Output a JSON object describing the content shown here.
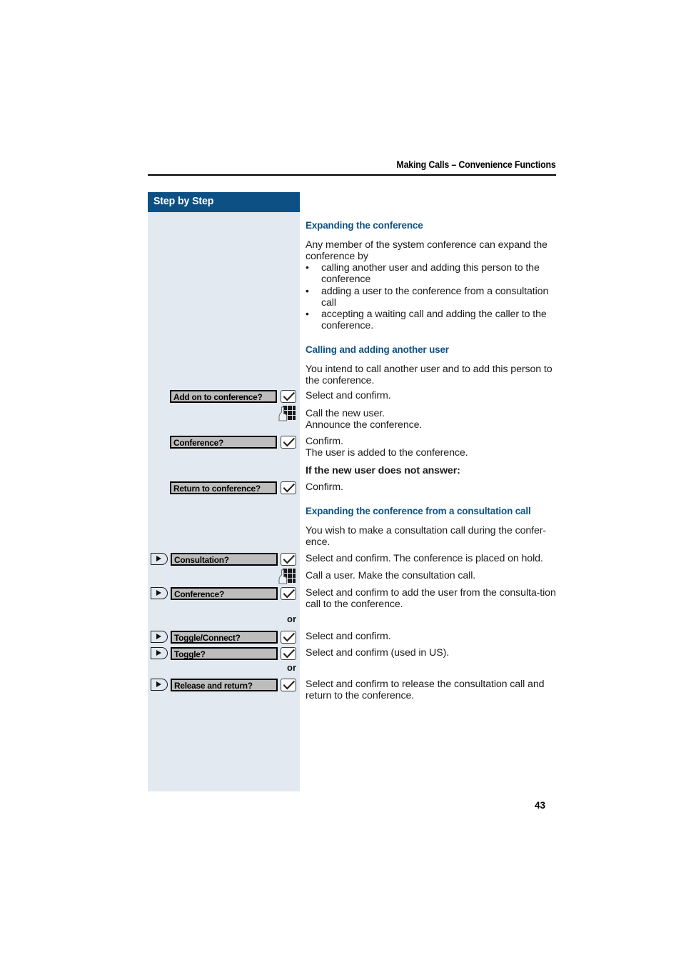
{
  "page": {
    "header_title": "Making Calls – Convenience Functions",
    "number": "43"
  },
  "sidebar": {
    "title": "Step by Step",
    "bar_color": "#0d5184",
    "background_color": "#e2e9f1",
    "or_labels": [
      "or",
      "or"
    ],
    "rows": [
      {
        "icon": "none",
        "field": "Add on to conference?",
        "button": "ok-check-button"
      },
      {
        "icon": "keypad-hand-icon",
        "field": null,
        "button": null
      },
      {
        "icon": "none",
        "field": "Conference?",
        "button": "ok-check-button"
      },
      {
        "icon": "none",
        "field": "Return to conference?",
        "button": "ok-check-button"
      },
      {
        "icon": "scroll-arrow-icon",
        "field": "Consultation?",
        "button": "ok-check-button"
      },
      {
        "icon": "keypad-hand-icon",
        "field": null,
        "button": null
      },
      {
        "icon": "scroll-arrow-icon",
        "field": "Conference?",
        "button": "ok-check-button"
      },
      {
        "icon": "scroll-arrow-icon",
        "field": "Toggle/Connect?",
        "button": "ok-check-button"
      },
      {
        "icon": "scroll-arrow-icon",
        "field": "Toggle?",
        "button": "ok-check-button"
      },
      {
        "icon": "scroll-arrow-icon",
        "field": "Release and return?",
        "button": "ok-check-button"
      }
    ]
  },
  "main": {
    "heading_color": "#0d5184",
    "section1": {
      "heading": "Expanding the conference",
      "intro": "Any member of the system conference can expand the conference by",
      "bullets": [
        "calling another user and adding this person to the conference",
        "adding a user to the conference from a consultation call",
        "accepting a waiting call and adding the caller to the conference."
      ]
    },
    "section2": {
      "heading": "Calling and adding another user",
      "intro": "You intend to call another user and to add this person to the conference.",
      "step1": "Select and confirm.",
      "step2_line1": "Call the new user.",
      "step2_line2": "Announce the conference.",
      "step3_line1": "Confirm.",
      "step3_line2": "The user is added to the conference.",
      "subhead": "If the new user does not answer:",
      "step4": "Confirm."
    },
    "section3": {
      "heading": "Expanding the conference from a consultation call",
      "intro": "You wish to make a consultation call during the confer-ence.",
      "step1": "Select and confirm. The conference is placed on hold.",
      "step2": "Call a user. Make the consultation call.",
      "step3": "Select and confirm to add the user from the consulta-tion call to the conference.",
      "step4": "Select and confirm.",
      "step5": "Select and confirm (used in US).",
      "step6": "Select and confirm to release the consultation call and return to the conference."
    }
  }
}
